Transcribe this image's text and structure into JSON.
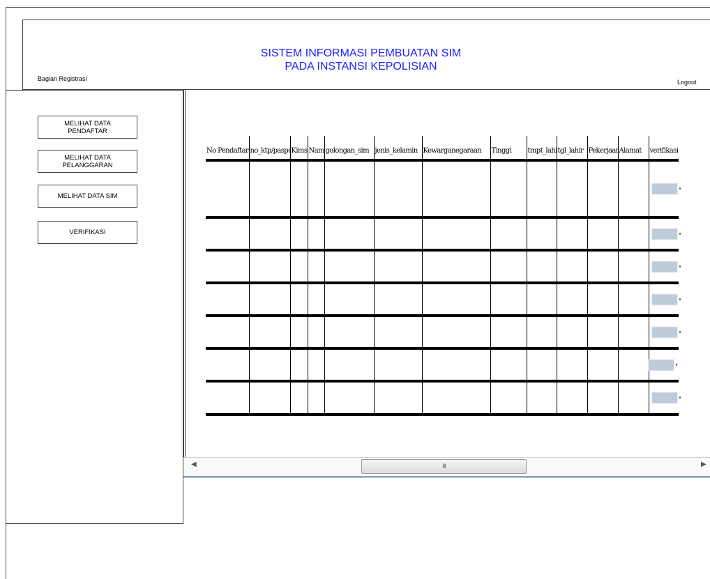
{
  "header": {
    "title_line1": "SISTEM INFORMASI PEMBUATAN SIM",
    "title_line2": "PADA INSTANSI KEPOLISIAN",
    "section_label": "Bagian Registrasi",
    "logout_label": "Logout",
    "title_color": "#2020ff"
  },
  "sidebar": {
    "items": [
      {
        "label": "MELIHAT DATA PENDAFTAR"
      },
      {
        "label": "MELIHAT DATA PELANGGARAN"
      },
      {
        "label": "MELIHAT DATA SIM"
      },
      {
        "label": "VERIFIKASI"
      }
    ]
  },
  "table": {
    "columns": [
      "No Pendaftaran",
      "no_ktp/paspor",
      "Kims",
      "Nama",
      "golongan_sim",
      "jenis_kelamin",
      "Kewarganegaraan",
      "Tinggi",
      "tmpt_lahir",
      "tgl_lahir",
      "Pekerjaan",
      "Alamat",
      "verifikasi"
    ],
    "rows": [
      [
        "",
        "",
        "",
        "",
        "",
        "",
        "",
        "",
        "",
        "",
        "",
        "",
        ""
      ],
      [
        "",
        "",
        "",
        "",
        "",
        "",
        "",
        "",
        "",
        "",
        "",
        "",
        ""
      ],
      [
        "",
        "",
        "",
        "",
        "",
        "",
        "",
        "",
        "",
        "",
        "",
        "",
        ""
      ],
      [
        "",
        "",
        "",
        "",
        "",
        "",
        "",
        "",
        "",
        "",
        "",
        "",
        ""
      ],
      [
        "",
        "",
        "",
        "",
        "",
        "",
        "",
        "",
        "",
        "",
        "",
        "",
        ""
      ],
      [
        "",
        "",
        "",
        "",
        "",
        "",
        "",
        "",
        "",
        "",
        "",
        "",
        ""
      ],
      [
        "",
        "",
        "",
        "",
        "",
        "",
        "",
        "",
        "",
        "",
        "",
        "",
        ""
      ]
    ]
  },
  "scrollbar": {
    "grip_symbol": "III",
    "left_arrow": "◀",
    "right_arrow": "▶"
  }
}
